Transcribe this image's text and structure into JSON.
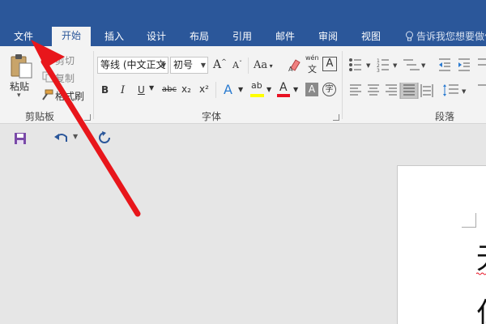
{
  "tabs": [
    {
      "label": "文件",
      "active": false
    },
    {
      "label": "开始",
      "active": true
    },
    {
      "label": "插入",
      "active": false
    },
    {
      "label": "设计",
      "active": false
    },
    {
      "label": "布局",
      "active": false
    },
    {
      "label": "引用",
      "active": false
    },
    {
      "label": "邮件",
      "active": false
    },
    {
      "label": "审阅",
      "active": false
    },
    {
      "label": "视图",
      "active": false
    }
  ],
  "tell_me": "告诉我您想要做什",
  "clipboard": {
    "paste": "粘贴",
    "cut": "剪切",
    "copy": "复制",
    "format_painter": "格式刷",
    "group_label": "剪贴板"
  },
  "font": {
    "font_name": "等线 (中文正文",
    "font_size": "初号",
    "change_case": "Aa",
    "phonetic_top": "wén",
    "phonetic_bottom": "文",
    "border_char": "A",
    "bold": "B",
    "italic": "I",
    "underline": "U",
    "strike": "abc",
    "subscript": "x₂",
    "superscript": "x²",
    "effects": "A",
    "highlight": "ab",
    "font_color": "A",
    "shading": "A",
    "enclose": "字",
    "grow": "A",
    "shrink": "A",
    "group_label": "字体"
  },
  "paragraph": {
    "group_label": "段落"
  },
  "document": {
    "line1_char": "无",
    "line2_char": "仁"
  },
  "colors": {
    "title_bar": "#2b579a",
    "ribbon": "#f3f3f3",
    "highlight_yellow": "#ffff00",
    "font_red": "#e81123",
    "arrow_red": "#e8161b"
  }
}
